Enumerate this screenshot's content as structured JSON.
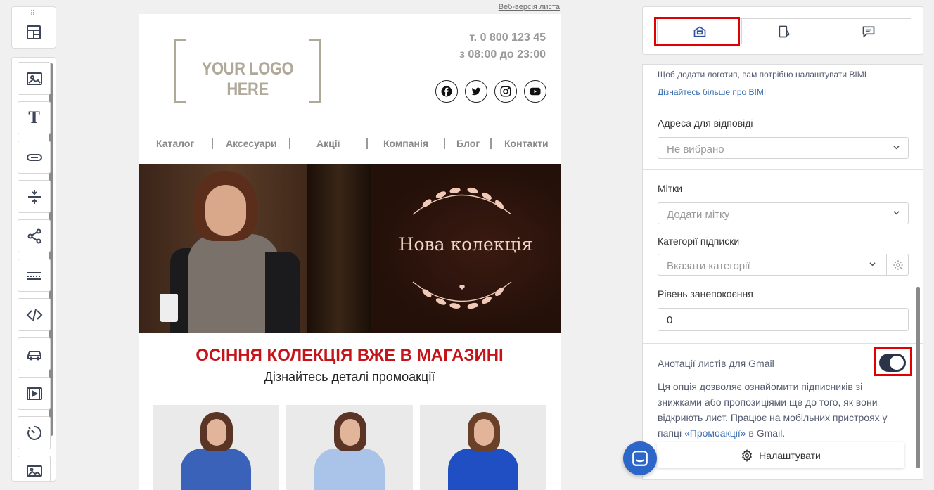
{
  "email": {
    "web_version": "Веб-версія листа",
    "logo_text": "YOUR LOGO HERE",
    "phone": "т. 0 800 123 45",
    "hours": "з 08:00 до 23:00",
    "socials": [
      "facebook-icon",
      "twitter-icon",
      "instagram-icon",
      "youtube-icon"
    ],
    "nav": [
      "Каталог",
      "Аксесуари",
      "Акції",
      "Компанія",
      "Блог",
      "Контакти"
    ],
    "banner_title": "Нова колекція",
    "headline": "ОСІННЯ КОЛЕКЦІЯ ВЖЕ В МАГАЗИНІ",
    "subline": "Дізнайтесь деталі промоакції",
    "headline_color": "#c4141a"
  },
  "panel": {
    "bimi_note": "Щоб додати логотип, вам потрібно налаштувати BIMI",
    "bimi_link": "Дізнайтесь більше про BIMI",
    "reply_label": "Адреса для відповіді",
    "reply_placeholder": "Не вибрано",
    "tags_label": "Мітки",
    "tags_placeholder": "Додати мітку",
    "categories_label": "Категорії підписки",
    "categories_placeholder": "Вказати категорії",
    "concern_label": "Рівень занепокоєння",
    "concern_value": "0",
    "gmail_label": "Анотації листів для Gmail",
    "gmail_desc_1": "Ця опція дозволяє ознайомити підписників зі знижками або пропозиціями ще до того, як вони відкриють лист. Працює на мобільних пристроях у папці ",
    "gmail_desc_link": "«Промоакції»",
    "gmail_desc_2": " в Gmail.",
    "configure_label": "Налаштувати",
    "toggle_on": true
  },
  "colors": {
    "accent": "#2c66c8",
    "highlight": "#e00000",
    "toggle": "#2a3347"
  }
}
